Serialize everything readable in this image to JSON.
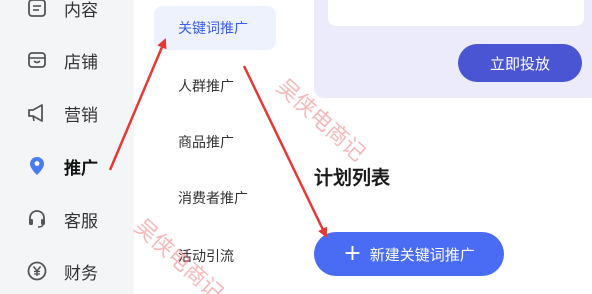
{
  "nav": {
    "items": [
      {
        "label": "内容",
        "icon": "content-icon"
      },
      {
        "label": "店铺",
        "icon": "store-icon"
      },
      {
        "label": "营销",
        "icon": "megaphone-icon"
      },
      {
        "label": "推广",
        "icon": "promotion-pin-icon",
        "active": true
      },
      {
        "label": "客服",
        "icon": "headset-icon"
      },
      {
        "label": "财务",
        "icon": "yuan-icon"
      }
    ]
  },
  "subnav": {
    "items": [
      {
        "label": "关键词推广",
        "active": true
      },
      {
        "label": "人群推广"
      },
      {
        "label": "商品推广"
      },
      {
        "label": "消费者推广"
      },
      {
        "label": "活动引流"
      }
    ]
  },
  "main": {
    "launch_button": "立即投放",
    "plan_title": "计划列表",
    "new_button_label": "新建关键词推广",
    "new_button_icon": "plus-icon"
  },
  "watermark": {
    "text": "吴侠电商记",
    "color": "#e64646"
  },
  "colors": {
    "accent": "#4a6cf4",
    "arrow": "#e53935",
    "active_sub_bg": "#eef2fd"
  }
}
